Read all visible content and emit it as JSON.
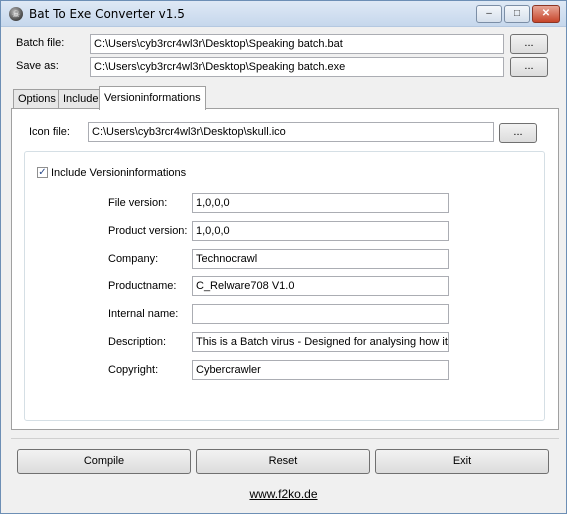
{
  "window": {
    "title": "Bat To Exe Converter v1.5",
    "icon": "app-skull-icon",
    "controls": {
      "minimize": "–",
      "maximize": "□",
      "close": "✕"
    }
  },
  "paths": {
    "batch_label": "Batch file:",
    "batch_value": "C:\\Users\\cyb3rcr4wl3r\\Desktop\\Speaking batch.bat",
    "save_label": "Save as:",
    "save_value": "C:\\Users\\cyb3rcr4wl3r\\Desktop\\Speaking batch.exe",
    "browse_label": "..."
  },
  "tabs": [
    {
      "label": "Options",
      "active": false
    },
    {
      "label": "Include",
      "active": false
    },
    {
      "label": "Versioninformations",
      "active": true
    }
  ],
  "icon_file": {
    "label": "Icon file:",
    "value": "C:\\Users\\cyb3rcr4wl3r\\Desktop\\skull.ico",
    "browse_label": "..."
  },
  "version_info": {
    "checkbox_label": "Include Versioninformations",
    "checked": true,
    "fields": [
      {
        "label": "File version:",
        "value": "1,0,0,0"
      },
      {
        "label": "Product version:",
        "value": "1,0,0,0"
      },
      {
        "label": "Company:",
        "value": "Technocrawl"
      },
      {
        "label": "Productname:",
        "value": "C_Relware708 V1.0"
      },
      {
        "label": "Internal name:",
        "value": ""
      },
      {
        "label": "Description:",
        "value": "This is a Batch virus - Designed for analysing how it work"
      },
      {
        "label": "Copyright:",
        "value": "Cybercrawler"
      }
    ]
  },
  "buttons": {
    "compile": "Compile",
    "reset": "Reset",
    "exit": "Exit"
  },
  "footer": {
    "link": "www.f2ko.de"
  }
}
